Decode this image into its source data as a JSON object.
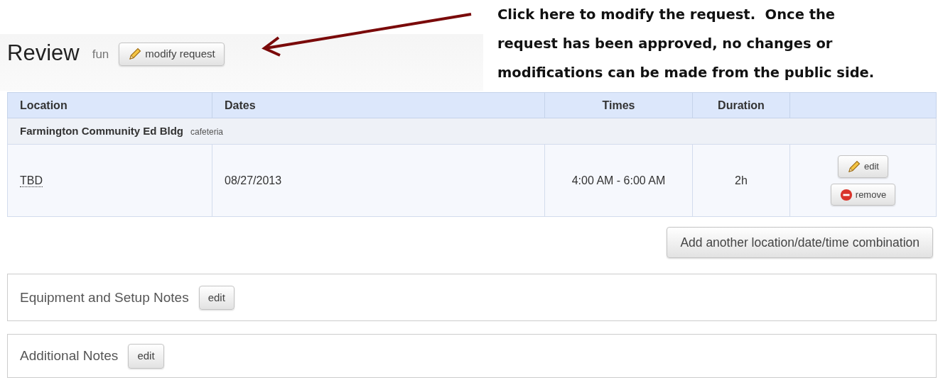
{
  "header": {
    "title": "Review",
    "subtitle": "fun",
    "button": "modify request"
  },
  "callout": {
    "lines": [
      "Click here to modify the request.  Once the",
      "request has been approved, no changes or",
      "modifications can be made from the public side."
    ]
  },
  "table": {
    "columns": [
      {
        "label": "Location"
      },
      {
        "label": "Dates"
      },
      {
        "label": "Times"
      },
      {
        "label": "Duration"
      },
      {}
    ],
    "group": {
      "name": "Farmington Community Ed Bldg",
      "note": "cafeteria"
    },
    "rows": [
      {
        "location": "TBD",
        "date": "08/27/2013",
        "times": "4:00 AM - 6:00 AM",
        "duration": "2h",
        "actions": [
          {
            "kind": "edit",
            "label": "edit"
          },
          {
            "kind": "remove",
            "label": "remove"
          }
        ]
      }
    ]
  },
  "add_button": "Add another location/date/time combination",
  "panels": [
    {
      "title": "Equipment and Setup Notes",
      "button": "edit"
    },
    {
      "title": "Additional Notes",
      "button": "edit"
    }
  ]
}
